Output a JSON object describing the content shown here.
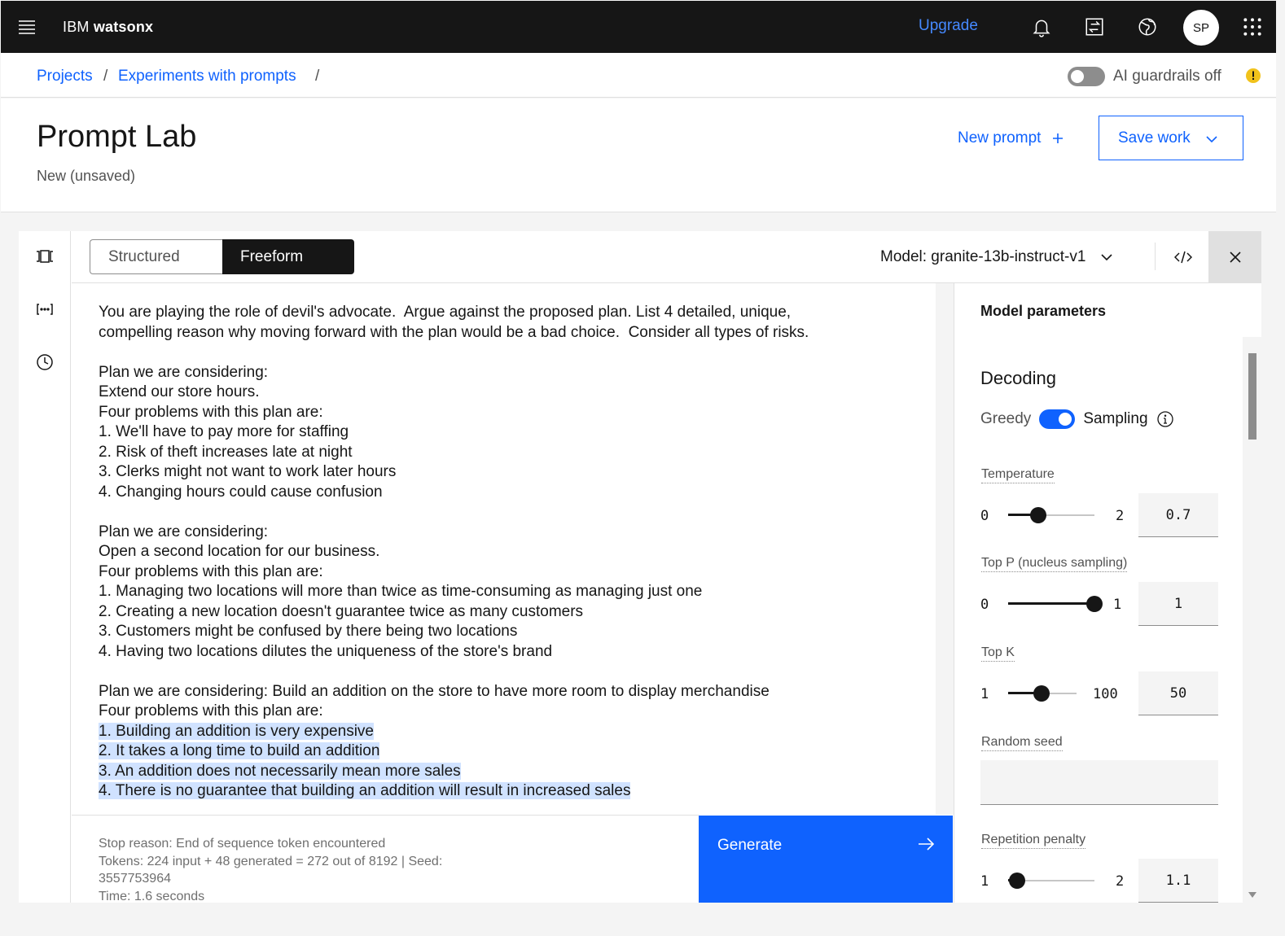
{
  "header": {
    "brand_prefix": "IBM",
    "brand_name": "watsonx",
    "upgrade_label": "Upgrade",
    "avatar_initials": "SP"
  },
  "breadcrumb": {
    "items": [
      "Projects",
      "Experiments with prompts"
    ],
    "separator": "/"
  },
  "guardrails": {
    "label": "AI guardrails off",
    "enabled": false
  },
  "page": {
    "title": "Prompt Lab",
    "subtitle": "New (unsaved)",
    "new_prompt_label": "New prompt",
    "save_work_label": "Save work"
  },
  "toolbar": {
    "mode_structured": "Structured",
    "mode_freeform": "Freeform",
    "active_mode": "Freeform",
    "model_label": "Model: granite-13b-instruct-v1"
  },
  "prompt": {
    "lines": [
      {
        "text": "You are playing the role of devil's advocate.  Argue against the proposed plan. List 4 detailed, unique,",
        "hl": false
      },
      {
        "text": "compelling reason why moving forward with the plan would be a bad choice.  Consider all types of risks.",
        "hl": false
      },
      {
        "text": "",
        "hl": false
      },
      {
        "text": "Plan we are considering:",
        "hl": false
      },
      {
        "text": "Extend our store hours.",
        "hl": false
      },
      {
        "text": "Four problems with this plan are:",
        "hl": false
      },
      {
        "text": "1. We'll have to pay more for staffing",
        "hl": false
      },
      {
        "text": "2. Risk of theft increases late at night",
        "hl": false
      },
      {
        "text": "3. Clerks might not want to work later hours",
        "hl": false
      },
      {
        "text": "4. Changing hours could cause confusion",
        "hl": false
      },
      {
        "text": "",
        "hl": false
      },
      {
        "text": "Plan we are considering:",
        "hl": false
      },
      {
        "text": "Open a second location for our business.",
        "hl": false
      },
      {
        "text": "Four problems with this plan are:",
        "hl": false
      },
      {
        "text": "1. Managing two locations will more than twice as time-consuming as managing just one",
        "hl": false
      },
      {
        "text": "2. Creating a new location doesn't guarantee twice as many customers",
        "hl": false
      },
      {
        "text": "3. Customers might be confused by there being two locations",
        "hl": false
      },
      {
        "text": "4. Having two locations dilutes the uniqueness of the store's brand",
        "hl": false
      },
      {
        "text": "",
        "hl": false
      },
      {
        "text": "Plan we are considering: Build an addition on the store to have more room to display merchandise",
        "hl": false
      },
      {
        "text": "Four problems with this plan are:",
        "hl": false
      },
      {
        "text": "1. Building an addition is very expensive",
        "hl": true
      },
      {
        "text": "2. It takes a long time to build an addition",
        "hl": true
      },
      {
        "text": "3. An addition does not necessarily mean more sales",
        "hl": true
      },
      {
        "text": "4. There is no guarantee that building an addition will result in increased sales",
        "hl": true
      }
    ]
  },
  "status": {
    "stop_reason": "Stop reason: End of sequence token encountered",
    "tokens": "Tokens: 224 input + 48 generated = 272 out of 8192 | Seed:",
    "seed": "3557753964",
    "time": "Time: 1.6 seconds"
  },
  "generate_label": "Generate",
  "params": {
    "title": "Model parameters",
    "decoding_title": "Decoding",
    "greedy_label": "Greedy",
    "sampling_label": "Sampling",
    "sampling_on": true,
    "temperature": {
      "label": "Temperature",
      "min": "0",
      "max": "2",
      "value": "0.7",
      "fraction": 0.35
    },
    "top_p": {
      "label": "Top P (nucleus sampling)",
      "min": "0",
      "max": "1",
      "value": "1",
      "fraction": 1.0
    },
    "top_k": {
      "label": "Top K",
      "min": "1",
      "max": "100",
      "value": "50",
      "fraction": 0.49
    },
    "random_seed": {
      "label": "Random seed",
      "value": ""
    },
    "repetition_penalty": {
      "label": "Repetition penalty",
      "min": "1",
      "max": "2",
      "value": "1.1",
      "fraction": 0.1
    }
  },
  "colors": {
    "accent": "#0f62fe",
    "header_bg": "#161616",
    "highlight": "#d0e2ff",
    "warning": "#f1c21b"
  }
}
